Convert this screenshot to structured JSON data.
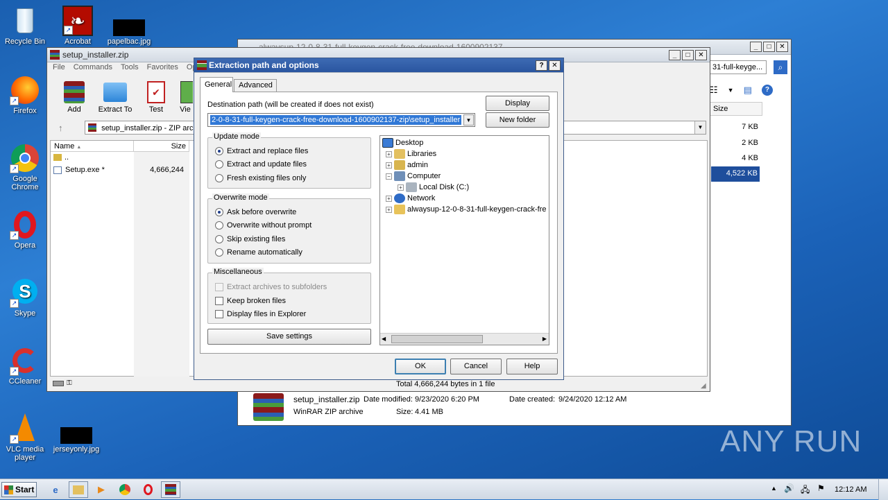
{
  "desktop": {
    "icons": [
      {
        "label": "Recycle Bin"
      },
      {
        "label": "Acrobat"
      },
      {
        "label": "papelbac.jpg"
      },
      {
        "label": "Firefox"
      },
      {
        "label": "Google Chrome"
      },
      {
        "label": "Opera"
      },
      {
        "label": "Skype"
      },
      {
        "label": "CCleaner"
      },
      {
        "label": "VLC media player"
      },
      {
        "label": "jerseyonly.jpg"
      }
    ],
    "watermark": "ANY RUN"
  },
  "explorer": {
    "title": "alwaysup-12-0-8-31-full-keygen-crack-free-download-1600902137",
    "search_text": "31-full-keyge...",
    "col_size": "Size",
    "sizes": [
      "7 KB",
      "2 KB",
      "4 KB",
      "4,522 KB"
    ],
    "details": {
      "filename": "setup_installer.zip",
      "modified_label": "Date modified:",
      "modified": "9/23/2020 6:20 PM",
      "created_label": "Date created:",
      "created": "9/24/2020 12:12 AM",
      "type": "WinRAR ZIP archive",
      "size_label": "Size:",
      "size": "4.41 MB"
    }
  },
  "winrar": {
    "title": "setup_installer.zip",
    "menu": [
      "File",
      "Commands",
      "Tools",
      "Favorites",
      "Opt"
    ],
    "toolbar": [
      "Add",
      "Extract To",
      "Test",
      "Vie"
    ],
    "address": "setup_installer.zip - ZIP arc",
    "col_name": "Name",
    "col_size": "Size",
    "rows": [
      {
        "name": "..",
        "size": ""
      },
      {
        "name": "Setup.exe *",
        "size": "4,666,244"
      }
    ],
    "status": "Total 4,666,244 bytes in 1 file"
  },
  "dialog": {
    "title": "Extraction path and options",
    "tabs": [
      "General",
      "Advanced"
    ],
    "dest_label": "Destination path (will be created if does not exist)",
    "dest_value": "2-0-8-31-full-keygen-crack-free-download-1600902137-zip\\setup_installer",
    "display_btn": "Display",
    "new_folder_btn": "New folder",
    "update_mode": {
      "title": "Update mode",
      "options": [
        "Extract and replace files",
        "Extract and update files",
        "Fresh existing files only"
      ],
      "selected": 0
    },
    "overwrite_mode": {
      "title": "Overwrite mode",
      "options": [
        "Ask before overwrite",
        "Overwrite without prompt",
        "Skip existing files",
        "Rename automatically"
      ],
      "selected": 0
    },
    "misc": {
      "title": "Miscellaneous",
      "options": [
        "Extract archives to subfolders",
        "Keep broken files",
        "Display files in Explorer"
      ]
    },
    "save_settings": "Save settings",
    "tree": [
      "Desktop",
      "Libraries",
      "admin",
      "Computer",
      "Local Disk (C:)",
      "Network",
      "alwaysup-12-0-8-31-full-keygen-crack-fre"
    ],
    "ok": "OK",
    "cancel": "Cancel",
    "help": "Help"
  },
  "taskbar": {
    "start": "Start",
    "time": "12:12 AM"
  }
}
